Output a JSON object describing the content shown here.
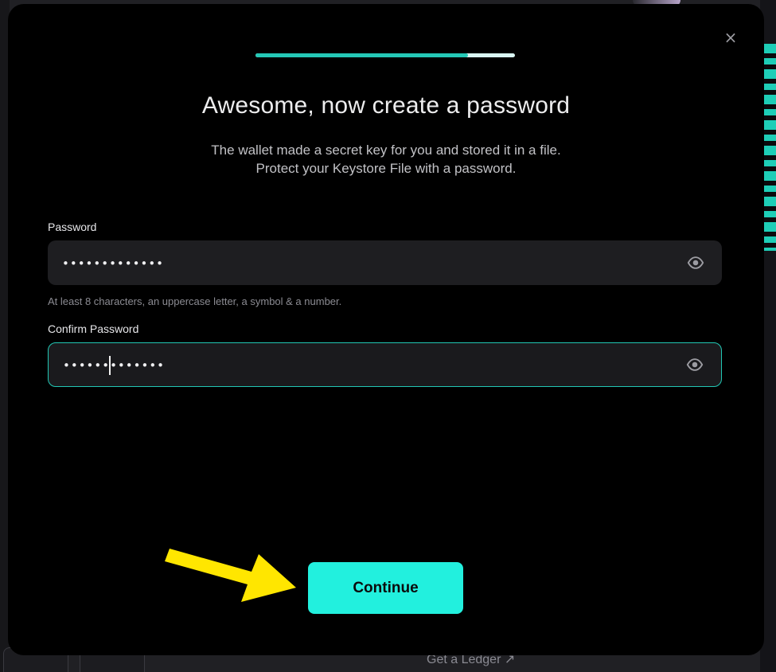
{
  "modal": {
    "close_label": "×",
    "progress_fraction": 0.82,
    "title": "Awesome, now create a password",
    "subtitle_line1": "The wallet made a secret key for you and stored it in a file.",
    "subtitle_line2": "Protect your Keystore File with a password.",
    "password": {
      "label": "Password",
      "value": "•••••••••••••",
      "icon": "eye-icon"
    },
    "hint": "At least 8 characters, an uppercase letter, a symbol & a number.",
    "confirm_password": {
      "label": "Confirm Password",
      "value": "•••••••••••••",
      "icon": "eye-icon"
    },
    "continue_label": "Continue"
  },
  "background": {
    "ledger_link": "Get a Ledger ↗"
  },
  "colors": {
    "accent": "#22f0de",
    "progress": "#24c8b6",
    "annotation_arrow": "#ffe600"
  }
}
